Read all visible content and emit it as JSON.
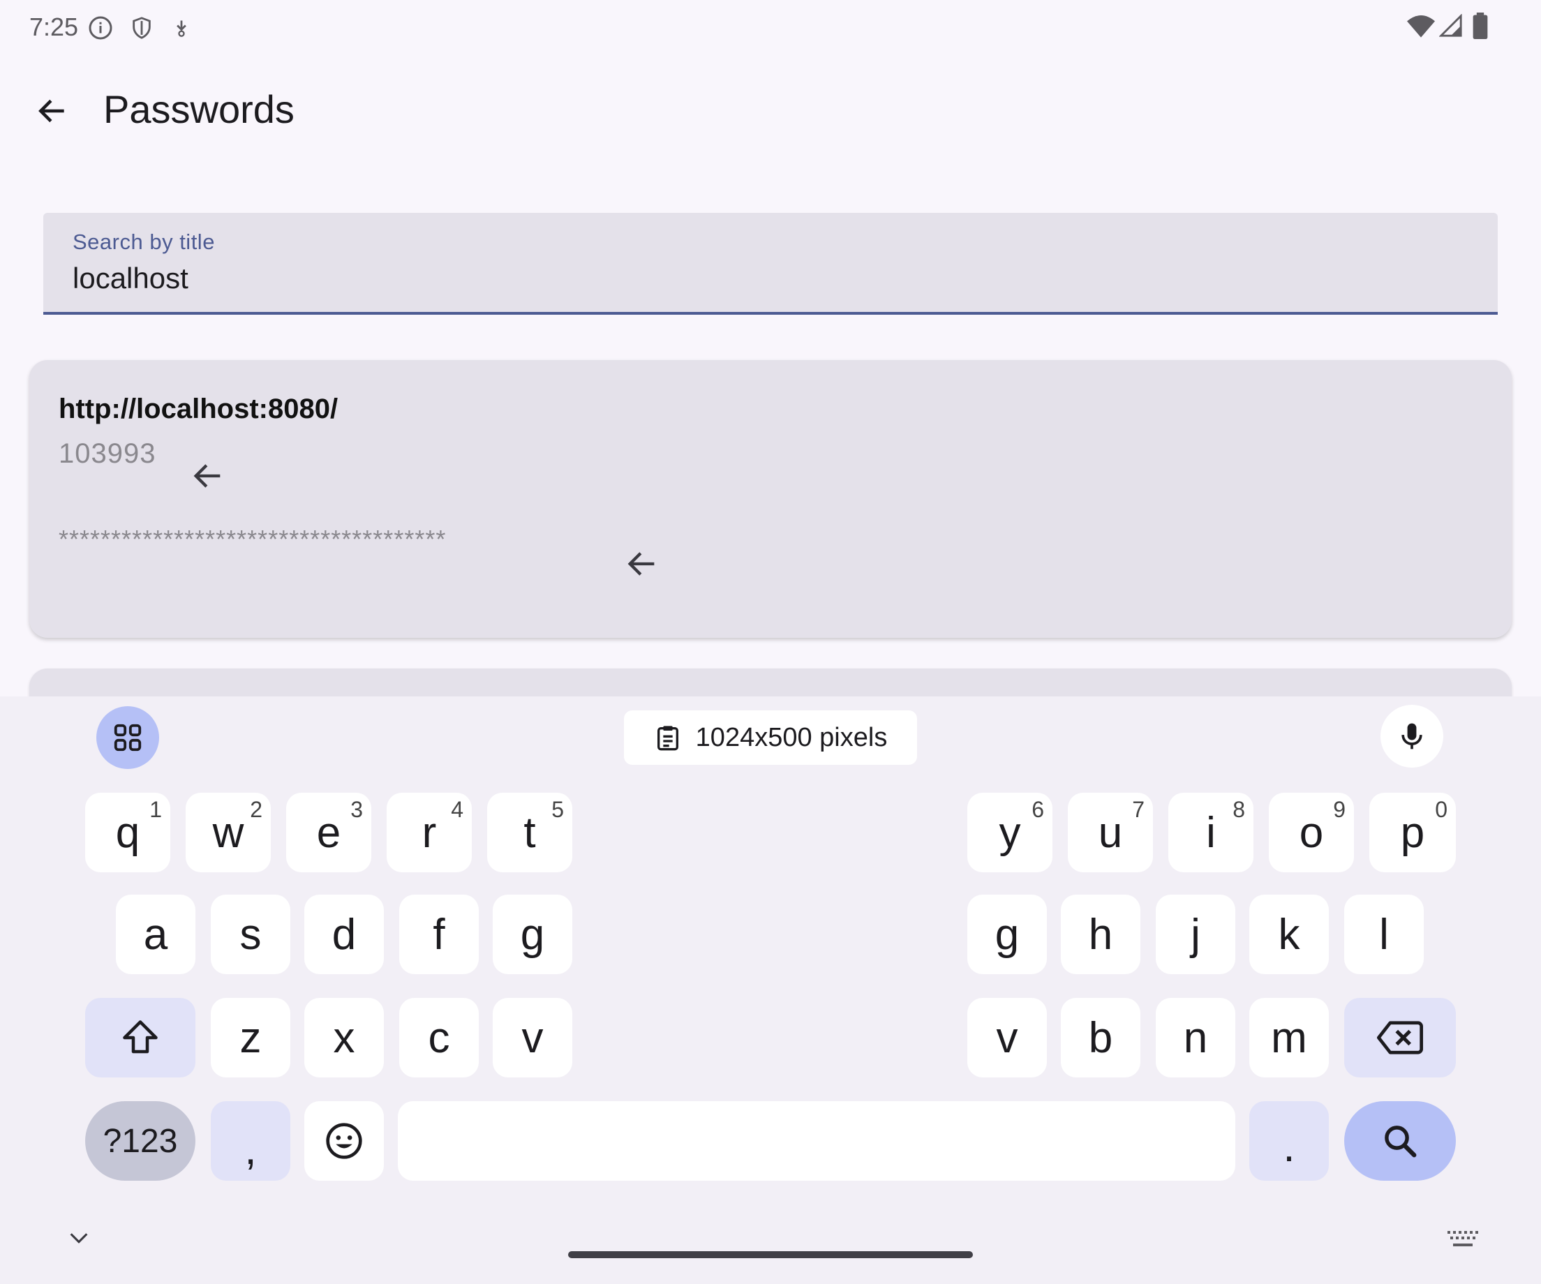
{
  "status_bar": {
    "time": "7:25",
    "icons": [
      "info-icon",
      "shield-icon",
      "download-icon",
      "wifi-icon",
      "signal-icon",
      "battery-icon"
    ]
  },
  "header": {
    "title": "Passwords",
    "back_icon": "arrow-back-icon"
  },
  "search": {
    "label": "Search by title",
    "value": "localhost"
  },
  "entries": [
    {
      "title": "http://localhost:8080/",
      "username": "103993",
      "password": "*************************************"
    }
  ],
  "keyboard": {
    "suggestion_chip": "1024x500 pixels",
    "row1": [
      {
        "key": "q",
        "hint": "1"
      },
      {
        "key": "w",
        "hint": "2"
      },
      {
        "key": "e",
        "hint": "3"
      },
      {
        "key": "r",
        "hint": "4"
      },
      {
        "key": "t",
        "hint": "5"
      },
      {
        "key": "y",
        "hint": "6"
      },
      {
        "key": "u",
        "hint": "7"
      },
      {
        "key": "i",
        "hint": "8"
      },
      {
        "key": "o",
        "hint": "9"
      },
      {
        "key": "p",
        "hint": "0"
      }
    ],
    "row2": [
      "a",
      "s",
      "d",
      "f",
      "g",
      "g",
      "h",
      "j",
      "k",
      "l"
    ],
    "row3": [
      "z",
      "x",
      "c",
      "v",
      "v",
      "b",
      "n",
      "m"
    ],
    "symbols_label": "?123",
    "comma_label": ",",
    "period_label": "."
  },
  "colors": {
    "background": "#f9f6fc",
    "card": "#e4e1ea",
    "accent": "#4c5a92",
    "keyboard_action": "#b5c0f6"
  }
}
